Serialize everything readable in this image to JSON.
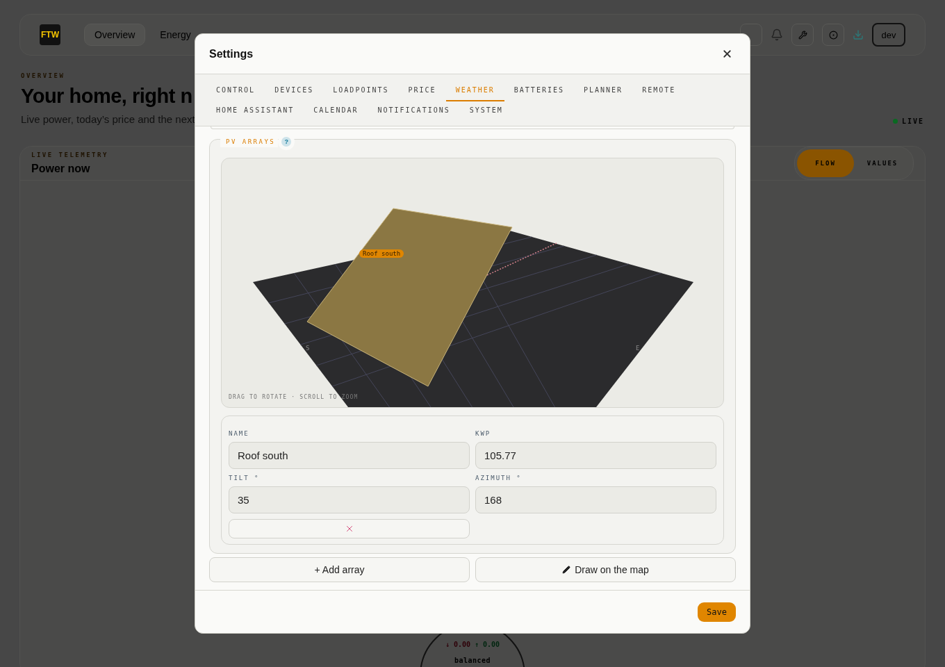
{
  "app_header": {
    "logo": "FTW",
    "nav": [
      {
        "label": "Overview",
        "selected": true
      },
      {
        "label": "Energy",
        "selected": false
      }
    ],
    "dev_button": "dev"
  },
  "page": {
    "eyebrow": "OVERVIEW",
    "title": "Your home, right n",
    "subtitle": "Live power, today’s price and the next",
    "live_status": "LIVE"
  },
  "telemetry_card": {
    "eyebrow": "LIVE TELEMETRY",
    "title": "Power now",
    "view_toggle": [
      {
        "label": "FLOW",
        "selected": true
      },
      {
        "label": "VALUES",
        "selected": false
      }
    ],
    "import_reading": "↓ 0.00",
    "export_reading": "↑ 0.00",
    "balance": "balanced"
  },
  "settings_dialog": {
    "title": "Settings",
    "tabs": [
      {
        "label": "CONTROL",
        "selected": false
      },
      {
        "label": "DEVICES",
        "selected": false
      },
      {
        "label": "LOADPOINTS",
        "selected": false
      },
      {
        "label": "PRICE",
        "selected": false
      },
      {
        "label": "WEATHER",
        "selected": true
      },
      {
        "label": "BATTERIES",
        "selected": false
      },
      {
        "label": "PLANNER",
        "selected": false
      },
      {
        "label": "REMOTE",
        "selected": false
      },
      {
        "label": "HOME ASSISTANT",
        "selected": false
      },
      {
        "label": "CALENDAR",
        "selected": false
      },
      {
        "label": "NOTIFICATIONS",
        "selected": false
      },
      {
        "label": "SYSTEM",
        "selected": false
      }
    ],
    "pv_arrays": {
      "legend": "PV ARRAYS",
      "help": "?",
      "viewer": {
        "array_label": "Roof south",
        "compass": [
          "S",
          "E"
        ],
        "hint": "DRAG TO ROTATE · SCROLL TO ZOOM"
      },
      "arrays": [
        {
          "fields": [
            {
              "label": "NAME",
              "value": "Roof south"
            },
            {
              "label": "KWP",
              "value": "105.77"
            },
            {
              "label": "TILT °",
              "value": "35"
            },
            {
              "label": "AZIMUTH °",
              "value": "168"
            }
          ]
        }
      ],
      "add_button": "+ Add array",
      "draw_button": "Draw on the map"
    },
    "save_button": "Save"
  }
}
